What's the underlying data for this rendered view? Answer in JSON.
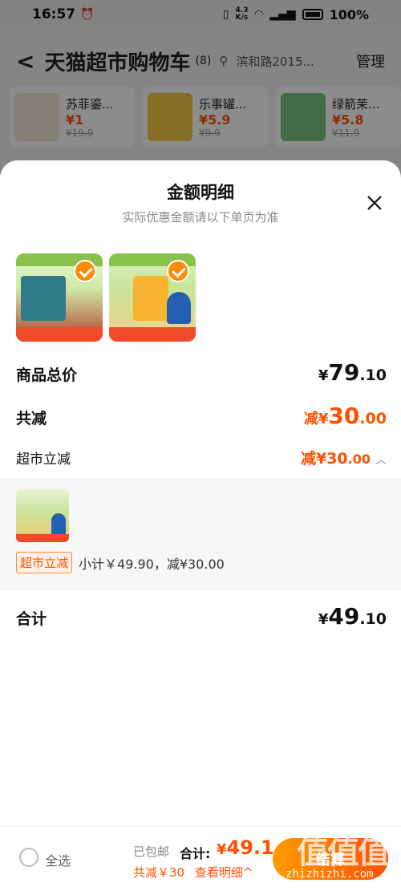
{
  "status": {
    "time": "16:57",
    "net_speed_top": "4.3",
    "net_speed_bot": "K/s",
    "battery": "100%"
  },
  "cart": {
    "back": "<",
    "title": "天猫超市购物车",
    "count": "(8)",
    "location": "滨和路2015...",
    "manage": "管理"
  },
  "reco": [
    {
      "name": "苏菲鎏...",
      "price_yen": "¥",
      "price": "1",
      "orig": "¥19.9"
    },
    {
      "name": "乐事罐...",
      "price_yen": "¥",
      "price": "5.9",
      "orig": "¥9.9"
    },
    {
      "name": "绿箭茉...",
      "price_yen": "¥",
      "price": "5.8",
      "orig": "¥11.9"
    }
  ],
  "sheet": {
    "title": "金额明细",
    "subtitle": "实际优惠金额请以下单页为准",
    "total_label": "商品总价",
    "total_yen": "¥",
    "total_int": "79",
    "total_dec": ".10",
    "reduce_label": "共减",
    "reduce_prefix": "减¥",
    "reduce_int": "30",
    "reduce_dec": ".00",
    "market_label": "超市立减",
    "market_prefix": "减¥",
    "market_int": "30",
    "market_dec": ".00",
    "detail_tag": "超市立减",
    "detail_text": "小计￥49.90，减¥30.00",
    "sum_label": "合计",
    "sum_yen": "¥",
    "sum_int": "49",
    "sum_dec": ".10"
  },
  "bottom": {
    "select_all": "全选",
    "free_ship": "已包邮",
    "sum_label": "合计:",
    "sum_yen": "¥",
    "sum_val": "49.1",
    "reduce_text": "共减￥30",
    "view_detail": "查看明细^",
    "checkout": "结算"
  },
  "watermark": {
    "logo": "值值值",
    "url": "zhizhizhi.com"
  },
  "colors": {
    "accent": "#ff5000",
    "accent_light": "#ff9b00"
  }
}
